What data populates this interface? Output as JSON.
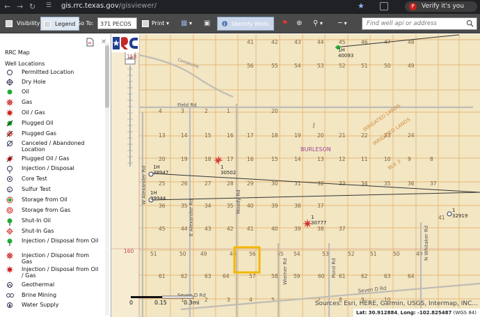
{
  "browser": {
    "url_host": "gis.rrc.texas.gov",
    "url_path": "/gisviewer/",
    "profile_badge": "Verify it's you",
    "profile_letter": "P"
  },
  "toolbar": {
    "visibility_label": "Visibility",
    "legend_label": "Legend",
    "goto_label": "Go To:",
    "goto_value": "371 PECOS",
    "print_label": "Print",
    "identify_label": "Identify Wells",
    "search_placeholder": "Find well api or address"
  },
  "legend": {
    "title": "RRC Map",
    "subtitle": "Well Locations",
    "items": [
      {
        "label": "Permitted Location",
        "icon": "permitted-location-icon"
      },
      {
        "label": "Dry Hole",
        "icon": "dry-hole-icon"
      },
      {
        "label": "Oil",
        "icon": "oil-icon"
      },
      {
        "label": "Gas",
        "icon": "gas-icon"
      },
      {
        "label": "Oil / Gas",
        "icon": "oil-gas-icon"
      },
      {
        "label": "Plugged Oil",
        "icon": "plugged-oil-icon"
      },
      {
        "label": "Plugged Gas",
        "icon": "plugged-gas-icon"
      },
      {
        "label": "Canceled / Abandoned Location",
        "icon": "canceled-location-icon"
      },
      {
        "label": "Plugged Oil / Gas",
        "icon": "plugged-oil-gas-icon"
      },
      {
        "label": "Injection / Disposal",
        "icon": "injection-disposal-icon"
      },
      {
        "label": "Core Test",
        "icon": "core-test-icon"
      },
      {
        "label": "Sulfur Test",
        "icon": "sulfur-test-icon"
      },
      {
        "label": "Storage from Oil",
        "icon": "storage-oil-icon"
      },
      {
        "label": "Storage from Gas",
        "icon": "storage-gas-icon"
      },
      {
        "label": "Shut-In Oil",
        "icon": "shut-in-oil-icon"
      },
      {
        "label": "Shut-In Gas",
        "icon": "shut-in-gas-icon"
      },
      {
        "label": "Injection / Disposal from Oil",
        "icon": "injection-oil-icon"
      },
      {
        "label": "Injection / Disposal from Gas",
        "icon": "injection-gas-icon"
      },
      {
        "label": "Injection / Disposal from Oil / Gas",
        "icon": "injection-oil-gas-icon"
      },
      {
        "label": "Geothermal",
        "icon": "geothermal-icon"
      },
      {
        "label": "Brine Mining",
        "icon": "brine-mining-icon"
      },
      {
        "label": "Water Supply",
        "icon": "water-supply-icon"
      }
    ]
  },
  "map": {
    "attribution": "Sources: Esri, HERE, Garmin, USGS, Intermap, INC...",
    "lat_label": "Lat:",
    "lat_value": "30.912884",
    "long_label": "Long:",
    "long_value": "-102.825487",
    "datum": "(WGS 84)",
    "scale_labels": [
      "0",
      "0.15",
      "0.3mi"
    ],
    "road_labels": [
      "Field Rd",
      "W Alexander Rd",
      "E Alexander Rd",
      "Moody Rd",
      "Wiemer Rd",
      "Pond Rd",
      "N Whitaker Rd",
      "Seven D Rd",
      "Seven D Rd",
      "Comanche"
    ],
    "area_labels": [
      "BURLESON",
      "IRRIGATED LANDS",
      "IRRIGATED LANDS",
      "BLK 3",
      "J"
    ],
    "section_numbers_top": [
      "41",
      "42",
      "43",
      "44",
      "45",
      "46"
    ],
    "well_labels": [
      {
        "id": "1H",
        "api": "40093"
      },
      {
        "id": "1H",
        "api": "38947"
      },
      {
        "id": "1",
        "api": "30502"
      },
      {
        "id": "1H",
        "api": "39944"
      },
      {
        "id": "1",
        "api": "30777"
      },
      {
        "id": "1",
        "api": "32919"
      }
    ],
    "block_numbers": [
      "158",
      "160"
    ]
  }
}
